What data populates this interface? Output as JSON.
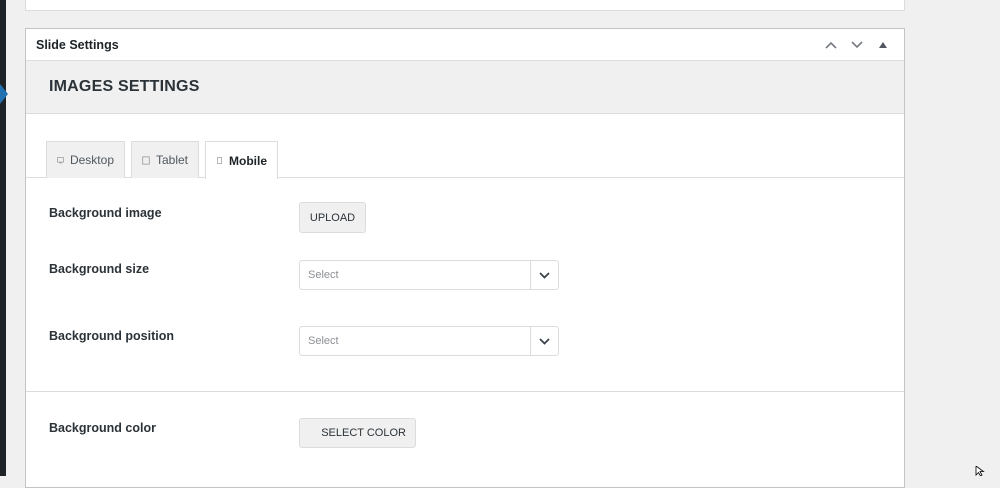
{
  "postbox": {
    "title": "Slide Settings",
    "actions": [
      "move-up",
      "move-down",
      "toggle-panel"
    ]
  },
  "section": {
    "title": "IMAGES SETTINGS"
  },
  "tabs": [
    {
      "label": "Desktop",
      "icon": "desktop-icon",
      "active": false
    },
    {
      "label": "Tablet",
      "icon": "tablet-icon",
      "active": false
    },
    {
      "label": "Mobile",
      "icon": "mobile-icon",
      "active": true
    }
  ],
  "fields": {
    "background_image": {
      "label": "Background image",
      "button": "UPLOAD"
    },
    "background_size": {
      "label": "Background size",
      "value": "Select"
    },
    "background_position": {
      "label": "Background position",
      "value": "Select"
    },
    "background_color": {
      "label": "Background color",
      "button": "SELECT COLOR"
    }
  },
  "colors": {
    "page_bg": "#f0f0f1",
    "panel_bg": "#ffffff",
    "border": "#dcdcde",
    "admin_accent": "#2271b1"
  }
}
